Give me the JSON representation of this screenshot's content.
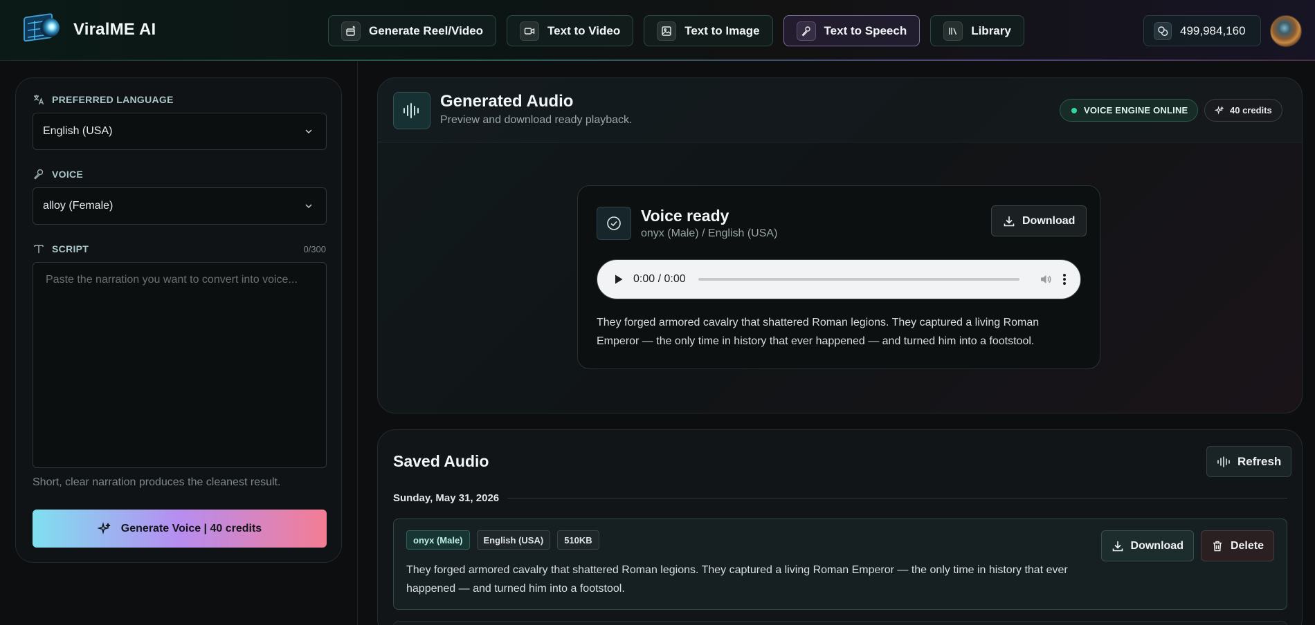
{
  "app": {
    "name": "ViralME AI"
  },
  "nav": {
    "items": [
      {
        "label": "Generate Reel/Video",
        "icon": "film-sparkle-icon",
        "active": false
      },
      {
        "label": "Text to Video",
        "icon": "video-camera-icon",
        "active": false
      },
      {
        "label": "Text to Image",
        "icon": "image-icon",
        "active": false
      },
      {
        "label": "Text to Speech",
        "icon": "microphone-icon",
        "active": true
      },
      {
        "label": "Library",
        "icon": "library-icon",
        "active": false
      }
    ]
  },
  "header": {
    "credits_balance": "499,984,160",
    "credits_icon": "coins-icon",
    "avatar_icon": "user-avatar"
  },
  "form": {
    "language": {
      "label": "PREFERRED LANGUAGE",
      "value": "English (USA)"
    },
    "voice": {
      "label": "VOICE",
      "value": "alloy (Female)"
    },
    "script": {
      "label": "SCRIPT",
      "count": "0/300",
      "placeholder": "Paste the narration you want to convert into voice...",
      "value": ""
    },
    "hint": "Short, clear narration produces the cleanest result.",
    "generate_button": "Generate Voice | 40 credits"
  },
  "generated": {
    "title": "Generated Audio",
    "subtitle": "Preview and download ready playback.",
    "status": "VOICE ENGINE ONLINE",
    "status_color": "#37d59a",
    "cost": "40 credits",
    "result": {
      "title": "Voice ready",
      "meta": "onyx (Male) / English (USA)",
      "download_label": "Download",
      "player_time": "0:00 / 0:00",
      "text": "They forged armored cavalry that shattered Roman legions. They captured a living Roman Emperor — the only time in history that ever happened — and turned him into a footstool."
    }
  },
  "saved": {
    "title": "Saved Audio",
    "refresh_label": "Refresh",
    "groups": [
      {
        "date": "Sunday, May 31, 2026",
        "items": [
          {
            "voice": "onyx (Male)",
            "language": "English (USA)",
            "size": "510KB",
            "text": "They forged armored cavalry that shattered Roman legions. They captured a living Roman Emperor — the only time in history that ever happened — and turned him into a footstool.",
            "download_label": "Download",
            "delete_label": "Delete"
          }
        ]
      }
    ]
  },
  "colors": {
    "accent_teal": "#37d59a",
    "gradient_start": "#7fe0f0",
    "gradient_mid": "#b78df0",
    "gradient_end": "#f47d94",
    "background": "#0c0e10"
  }
}
